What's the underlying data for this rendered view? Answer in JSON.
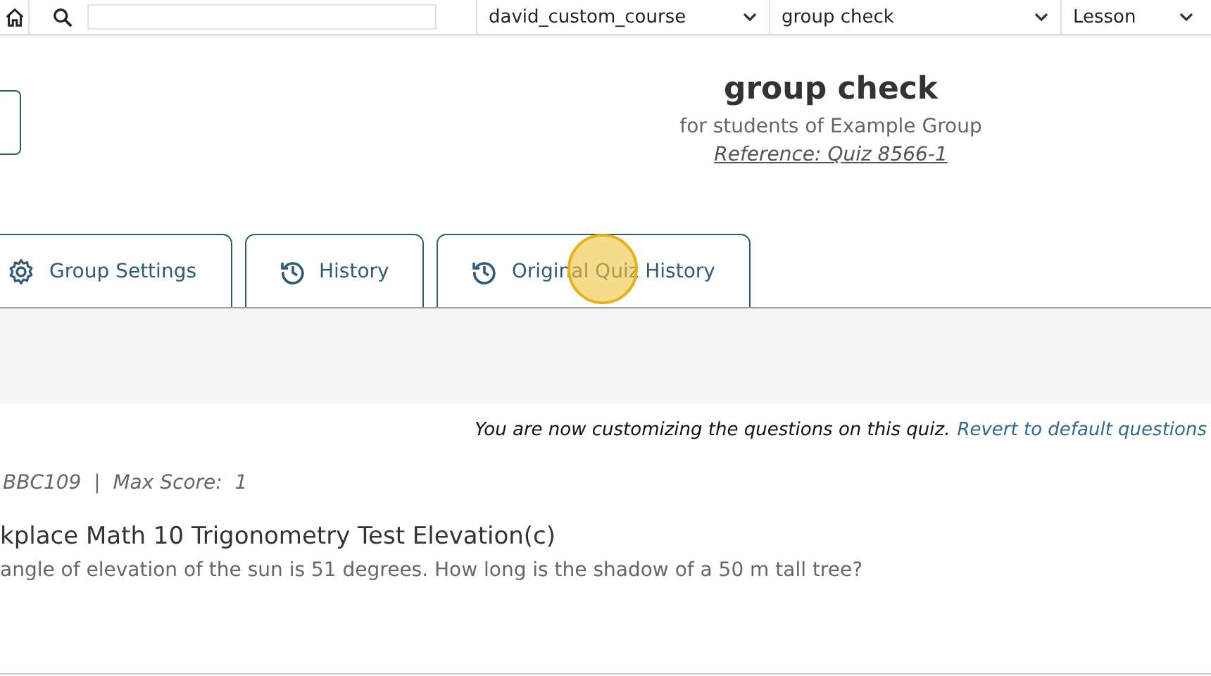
{
  "topbar": {
    "dropdowns": [
      {
        "value": "david_custom_course"
      },
      {
        "value": "group check"
      },
      {
        "value": "Lesson"
      }
    ]
  },
  "header": {
    "title": "group check",
    "subtitle": "for students of Example Group",
    "reference": "Reference: Quiz 8566-1"
  },
  "tabs": [
    {
      "label": "Group Settings",
      "kind": "settings",
      "selected": false
    },
    {
      "label": "History",
      "kind": "history",
      "selected": false
    },
    {
      "label": "Original Quiz History",
      "kind": "history",
      "selected": false
    }
  ],
  "notice": {
    "text": "You are now customizing the questions on this quiz.",
    "link": "Revert to default questions"
  },
  "question": {
    "meta": "BBC109  |  Max Score:  1",
    "title": "kplace Math 10 Trigonometry Test Elevation(c)",
    "body": "angle of elevation of the sun is 51 degrees. How long is the shadow of a 50 m tall tree?"
  }
}
